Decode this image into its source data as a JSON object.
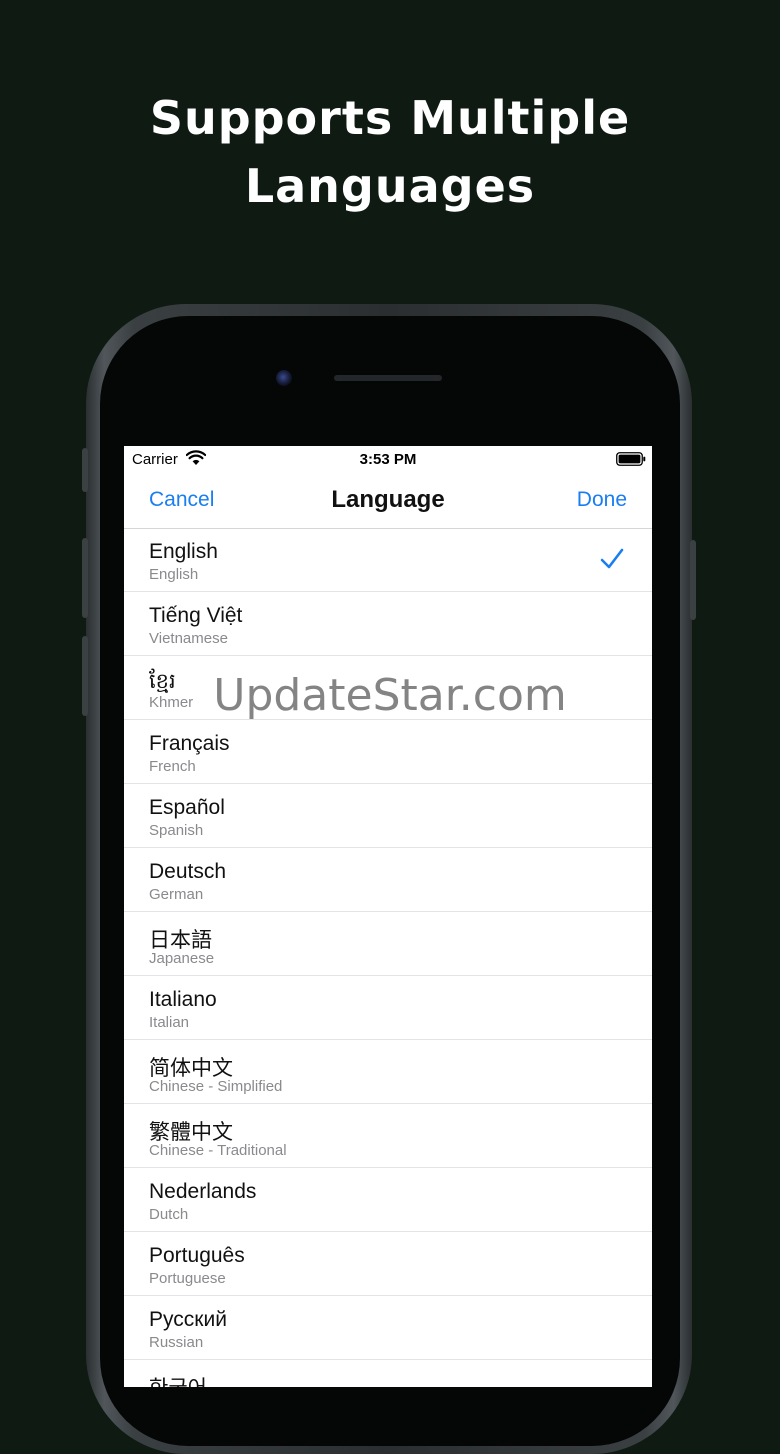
{
  "headline": {
    "line1": "Supports Multiple",
    "line2": "Languages"
  },
  "status_bar": {
    "carrier": "Carrier",
    "time": "3:53 PM",
    "icons": [
      "wifi-icon",
      "battery-icon"
    ]
  },
  "nav": {
    "cancel": "Cancel",
    "title": "Language",
    "done": "Done"
  },
  "languages": [
    {
      "native": "English",
      "english": "English",
      "selected": true
    },
    {
      "native": "Tiếng Việt",
      "english": "Vietnamese",
      "selected": false
    },
    {
      "native": "ខ្មែរ",
      "english": "Khmer",
      "selected": false
    },
    {
      "native": "Français",
      "english": "French",
      "selected": false
    },
    {
      "native": "Español",
      "english": "Spanish",
      "selected": false
    },
    {
      "native": "Deutsch",
      "english": "German",
      "selected": false
    },
    {
      "native": "日本語",
      "english": "Japanese",
      "selected": false
    },
    {
      "native": "Italiano",
      "english": "Italian",
      "selected": false
    },
    {
      "native": "简体中文",
      "english": "Chinese - Simplified",
      "selected": false
    },
    {
      "native": "繁體中文",
      "english": "Chinese - Traditional",
      "selected": false
    },
    {
      "native": "Nederlands",
      "english": "Dutch",
      "selected": false
    },
    {
      "native": "Português",
      "english": "Portuguese",
      "selected": false
    },
    {
      "native": "Русский",
      "english": "Russian",
      "selected": false
    },
    {
      "native": "한국어",
      "english": "",
      "selected": false
    }
  ],
  "watermark": "UpdateStar.com",
  "colors": {
    "background": "#0e1a12",
    "accent": "#1a7ef2",
    "secondary_text": "#8a8a8e"
  }
}
